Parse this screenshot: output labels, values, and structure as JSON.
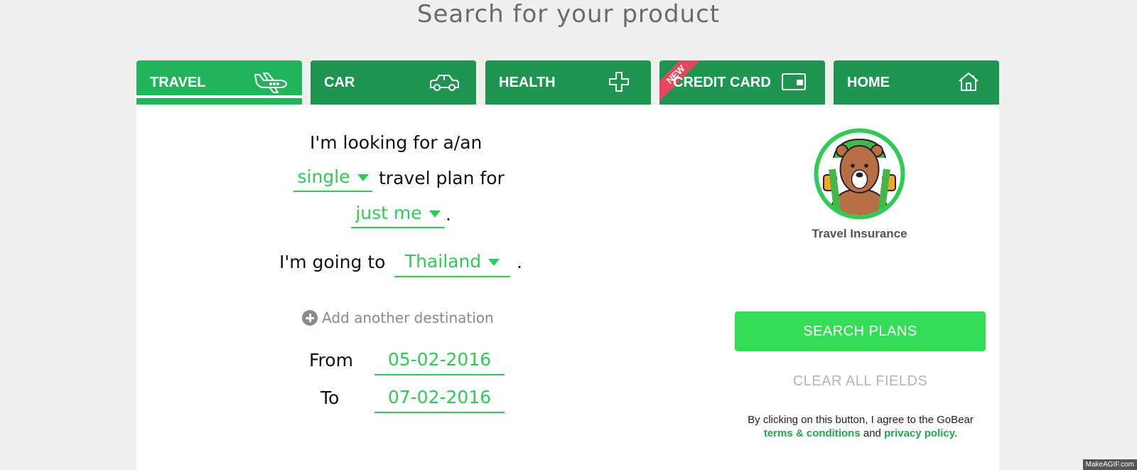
{
  "page": {
    "title": "Search for your product"
  },
  "tabs": [
    {
      "label": "TRAVEL",
      "icon": "airplane-icon",
      "active": true
    },
    {
      "label": "CAR",
      "icon": "car-icon",
      "active": false
    },
    {
      "label": "HEALTH",
      "icon": "plus-icon",
      "active": false
    },
    {
      "label": "CREDIT CARD",
      "icon": "credit-card-icon",
      "active": false,
      "badge": "NEW"
    },
    {
      "label": "HOME",
      "icon": "house-icon",
      "active": false
    }
  ],
  "form": {
    "line1": "I'm looking for a/an",
    "plan_type": "single",
    "line2_suffix": "travel plan for",
    "travelers": "just me",
    "period": ".",
    "going_to": "I'm going to",
    "destination": "Thailand",
    "add_destination": "Add another destination",
    "from_label": "From",
    "from_date": "05-02-2016",
    "to_label": "To",
    "to_date": "07-02-2016"
  },
  "sidebar": {
    "mascot_icon": "bear-backpack-icon",
    "caption": "Travel Insurance",
    "search_button": "SEARCH PLANS",
    "clear_button": "CLEAR ALL FIELDS",
    "disclaimer_pre": "By clicking on this button, I agree to the GoBear",
    "terms_link": "terms & conditions",
    "and": "and",
    "privacy_link": "privacy policy."
  },
  "colors": {
    "tab_bg": "#1e9651",
    "tab_active_bg": "#20b45b",
    "accent_green": "#2ecc55",
    "button_green": "#33dd55",
    "ribbon_red": "#e8465e"
  },
  "watermark": "MakeAGIF.com"
}
